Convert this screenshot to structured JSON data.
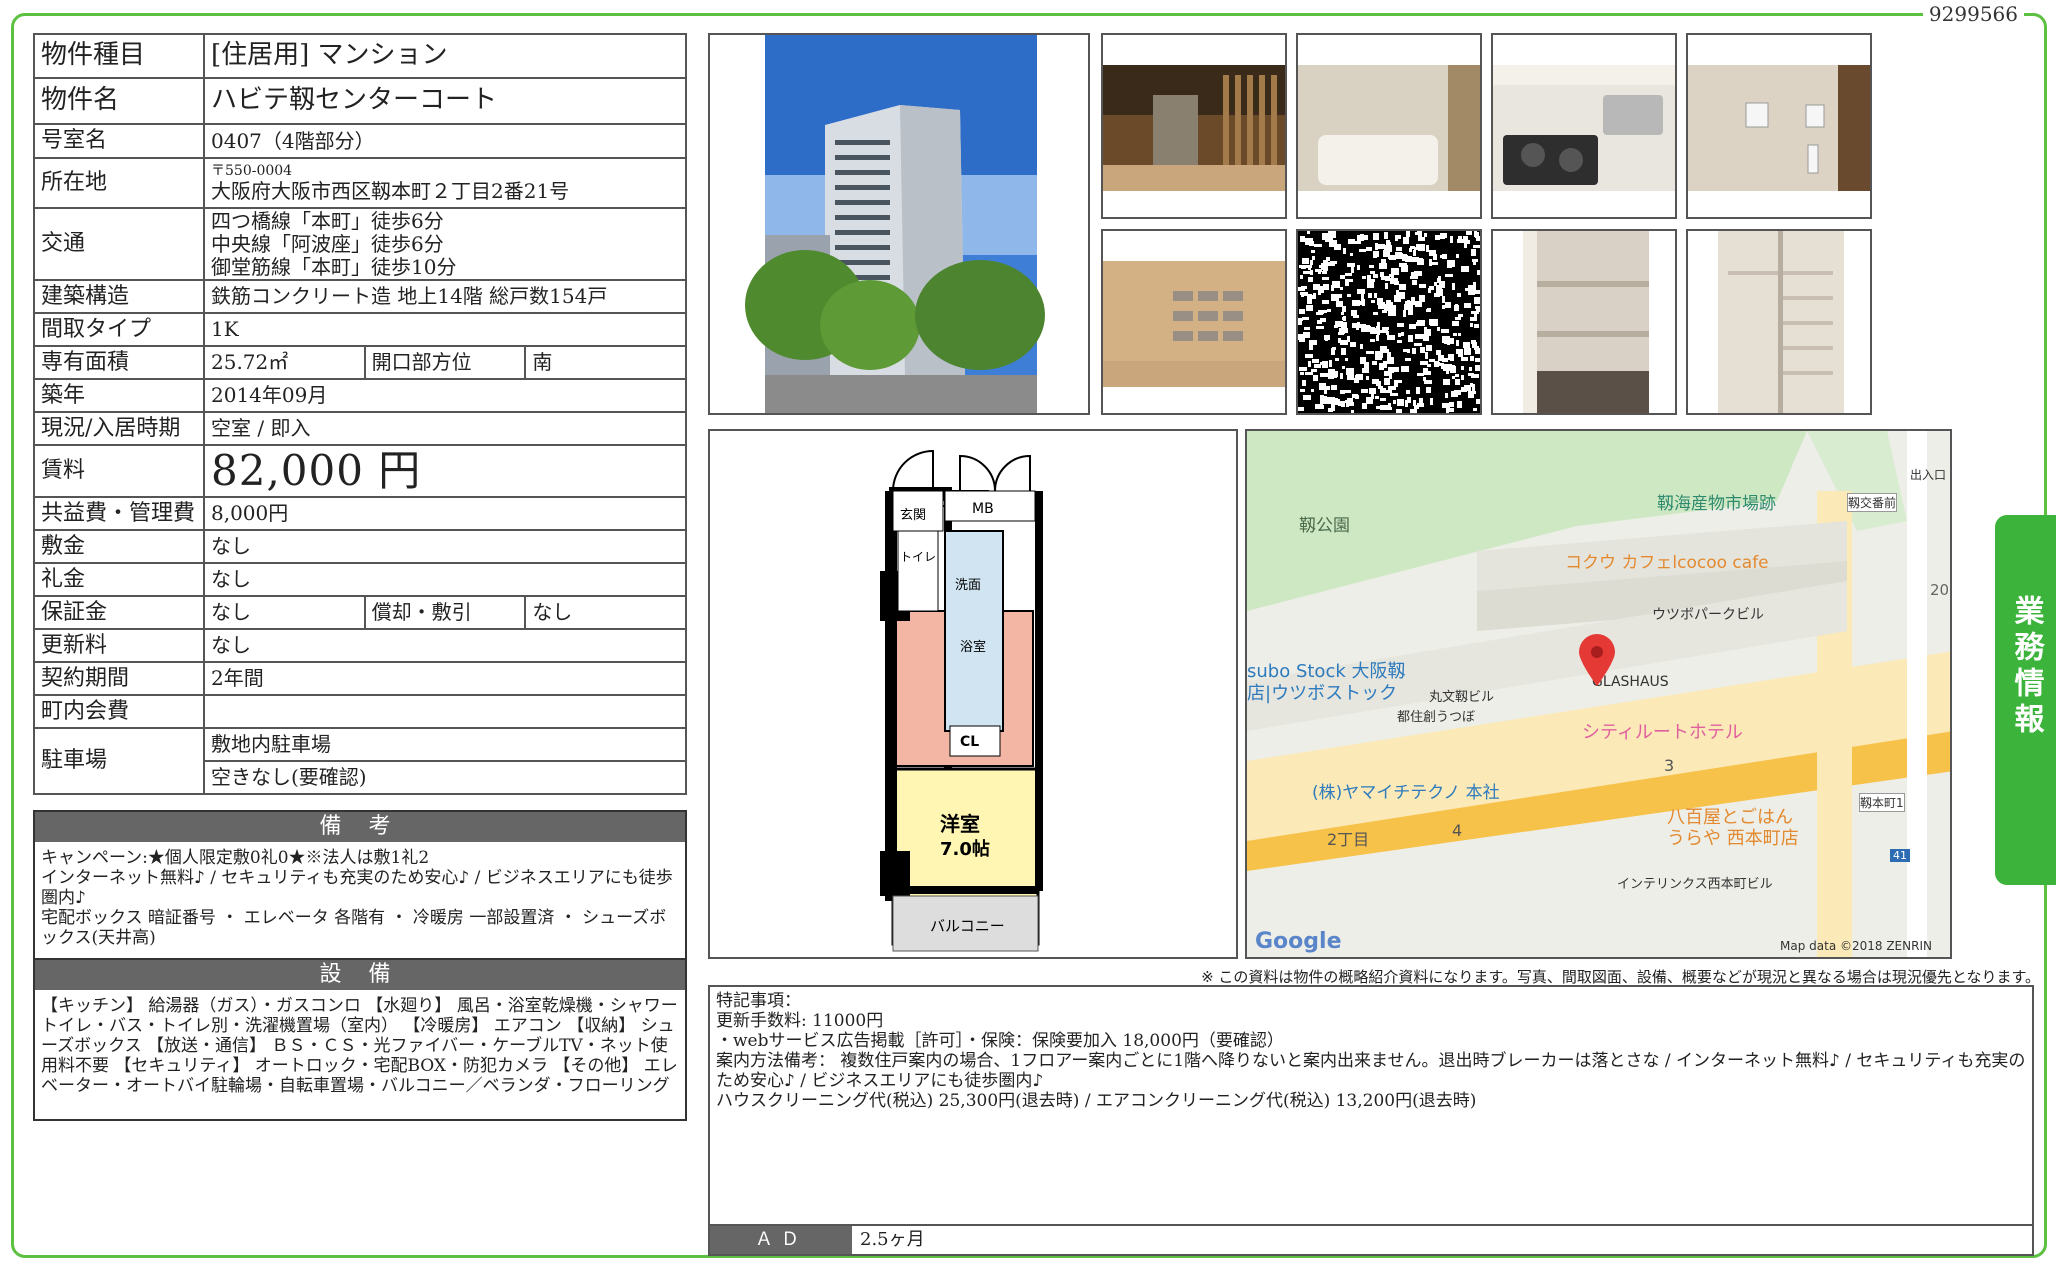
{
  "doc_id": "9299566",
  "spec": {
    "rows": [
      {
        "label": "物件種目",
        "value": "[住居用]  マンション"
      },
      {
        "label": "物件名",
        "value": "ハビテ靱センターコート"
      },
      {
        "label": "号室名",
        "value": "0407（4階部分）"
      },
      {
        "label": "所在地",
        "zip": "〒550-0004",
        "value": "大阪府大阪市西区靱本町２丁目2番21号"
      },
      {
        "label": "交通",
        "lines": [
          "四つ橋線「本町」徒歩6分",
          "中央線「阿波座」徒歩6分",
          "御堂筋線「本町」徒歩10分"
        ]
      },
      {
        "label": "建築構造",
        "value": "鉄筋コンクリート造  地上14階  総戸数154戸"
      },
      {
        "label": "間取タイプ",
        "value": "1K"
      },
      {
        "label": "専有面積",
        "value": "25.72㎡",
        "label2": "開口部方位",
        "value2": "南"
      },
      {
        "label": "築年",
        "value": "2014年09月"
      },
      {
        "label": "現況/入居時期",
        "value": "空室  /  即入"
      },
      {
        "label": "賃料",
        "value": "82,000 円"
      },
      {
        "label": "共益費・管理費",
        "value": "8,000円"
      },
      {
        "label": "敷金",
        "value": "なし"
      },
      {
        "label": "礼金",
        "value": "なし"
      },
      {
        "label": "保証金",
        "value": "なし",
        "label2": "償却・敷引",
        "value2": "なし"
      },
      {
        "label": "更新料",
        "value": "なし"
      },
      {
        "label": "契約期間",
        "value": "2年間"
      },
      {
        "label": "町内会費",
        "value": ""
      },
      {
        "label": "駐車場",
        "lines": [
          "敷地内駐車場",
          "空きなし(要確認)"
        ]
      }
    ]
  },
  "remarks": {
    "header": "備 考",
    "text": "キャンペーン:★個人限定敷0礼0★※法人は敷1礼2\nインターネット無料♪ / セキュリティも充実のため安心♪ / ビジネスエリアにも徒歩圏内♪\n宅配ボックス 暗証番号 ・ エレベータ 各階有 ・ 冷暖房 一部設置済 ・ シューズボックス(天井高)"
  },
  "facilities": {
    "header": "設 備",
    "text": "【キッチン】 給湯器（ガス）・ガスコンロ 【水廻り】 風呂・浴室乾燥機・シャワートイレ・バス・トイレ別・洗濯機置場（室内） 【冷暖房】 エアコン 【収納】 シューズボックス 【放送・通信】 ＢＳ・ＣＳ・光ファイバー・ケーブルTV・ネット使用料不要 【セキュリティ】 オートロック・宅配BOX・防犯カメラ 【その他】 エレベーター・オートバイ駐輪場・自転車置場・バルコニー／ベランダ・フローリング"
  },
  "floor_plan": {
    "labels": [
      "玄関",
      "MB",
      "トイレ",
      "洗面",
      "浴室",
      "CL",
      "洋室",
      "7.0帖",
      "バルコニー"
    ]
  },
  "map": {
    "labels": [
      "靱公園",
      "靱海産物市場跡",
      "靱交番前",
      "出入口",
      "コクウ カフェlcocoo cafe",
      "20",
      "ウツボパークビル",
      "GLASHAUS",
      "subo Stock 大阪靱",
      "店|ウツボストック",
      "丸文靱ビル",
      "都住創うつぼ",
      "シティルートホテル",
      "3",
      "(株)ヤマイチテクノ 本社",
      "2丁目",
      "4",
      "八百屋とごはん",
      "うらや 西本町店",
      "靱本町1",
      "インテリンクス西本町ビル",
      "41",
      "Google",
      "Map data ©2018 ZENRIN"
    ]
  },
  "disclaimer": "※ この資料は物件の概略紹介資料になります。写真、間取図面、設備、概要などが現況と異なる場合は現況優先となります。",
  "notes": {
    "text": "特記事項：\n更新手数料: 11000円\n・webサービス広告掲載［許可］・保険：保険要加入 18,000円（要確認）\n案内方法備考： 複数住戸案内の場合、1フロアー案内ごとに1階へ降りないと案内出来ません。退出時ブレーカーは落とさな / インターネット無料♪ / セキュリティも充実のため安心♪ / ビジネスエリアにも徒歩圏内♪\nハウスクリーニング代(税込) 25,300円(退去時) / エアコンクリーニング代(税込) 13,200円(退去時)",
    "ad_label": "ＡＤ",
    "ad_value": "2.5ヶ月"
  },
  "side_tab": "業務情報",
  "colors": {
    "frame": "#5cc040",
    "tab": "#3cb43c",
    "header_gray": "#666666"
  }
}
